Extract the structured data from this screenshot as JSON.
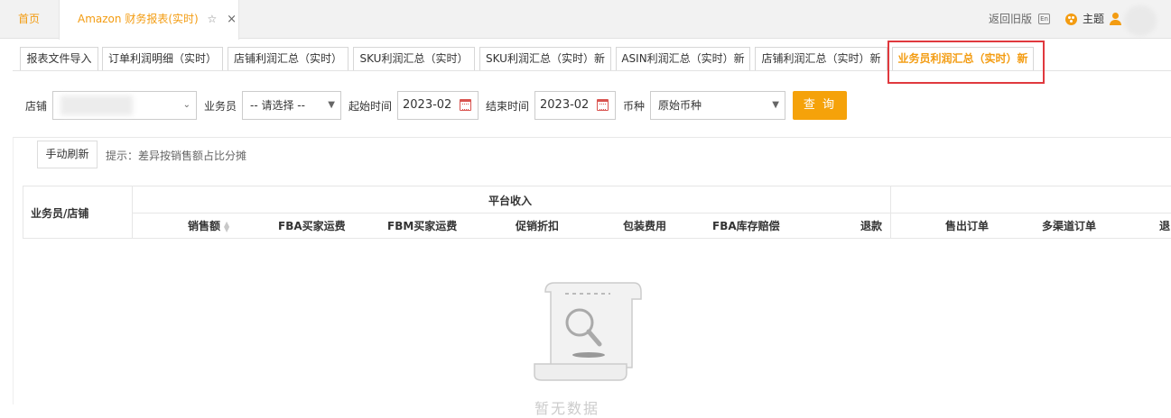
{
  "top_tabs": {
    "home": "首页",
    "active_title": "Amazon 财务报表(实时)",
    "star_glyph": "☆",
    "close_glyph": "×"
  },
  "top_right": {
    "legacy": "返回旧版",
    "lang_icon_text": "En",
    "theme": "主题"
  },
  "sub_tabs": [
    "报表文件导入",
    "订单利润明细（实时）",
    "店铺利润汇总（实时）",
    "SKU利润汇总（实时）",
    "SKU利润汇总（实时）新",
    "ASIN利润汇总（实时）新",
    "店铺利润汇总（实时）新",
    "业务员利润汇总（实时）新"
  ],
  "filters": {
    "store_label": "店铺",
    "salesperson_label": "业务员",
    "salesperson_value": "-- 请选择 --",
    "start_label": "起始时间",
    "start_value": "2023-02",
    "end_label": "结束时间",
    "end_value": "2023-02",
    "currency_label": "币种",
    "currency_value": "原始币种",
    "query_button": "查 询"
  },
  "toolbar": {
    "refresh_button": "手动刷新",
    "tip": "提示：差异按销售额占比分摊"
  },
  "table": {
    "first_col": "业务员/店铺",
    "group_header": "平台收入",
    "columns": [
      "销售额",
      "FBA买家运费",
      "FBM买家运费",
      "促销折扣",
      "包装费用",
      "FBA库存赔偿",
      "退款",
      "售出订单",
      "多渠道订单",
      "退"
    ]
  },
  "empty": {
    "text": "暂无数据"
  },
  "colors": {
    "accent": "#f39c12",
    "query_button": "#f5a20a",
    "highlight_box": "#e0393e"
  }
}
